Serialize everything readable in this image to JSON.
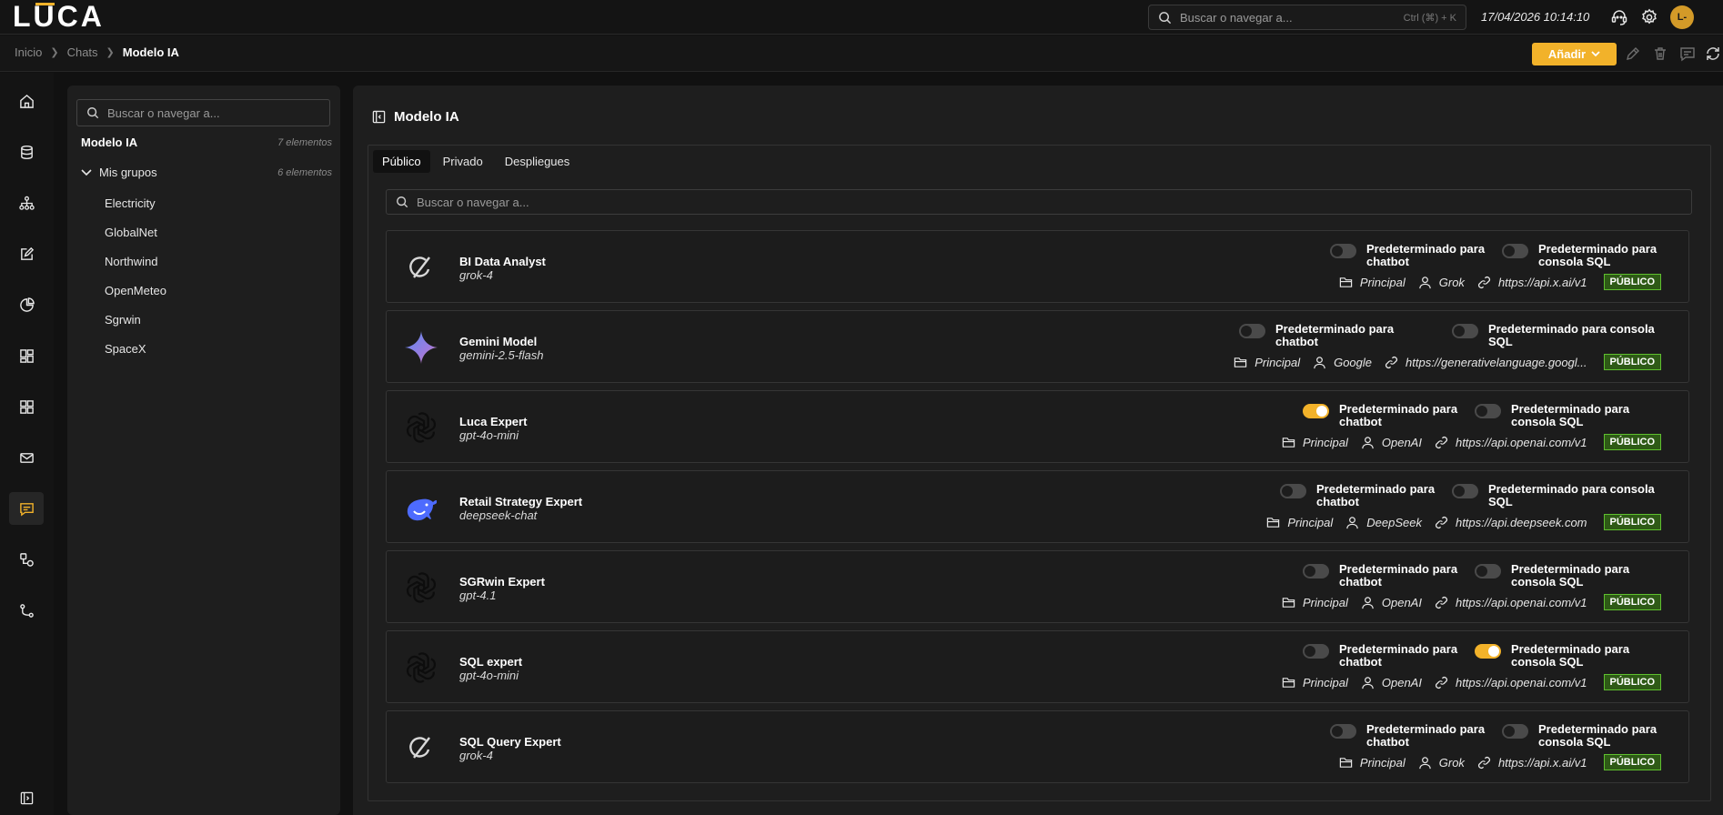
{
  "header": {
    "logo_text": "LUCA",
    "search_placeholder": "Buscar o navegar a...",
    "search_shortcut": "Ctrl (⌘) + K",
    "datetime": "17/04/2026 10:14:10",
    "avatar_initials": "L-",
    "accent_color": "#f2b22a"
  },
  "breadcrumb": {
    "items": [
      "Inicio",
      "Chats"
    ],
    "current": "Modelo IA"
  },
  "toolbar": {
    "add_label": "Añadir"
  },
  "sidebar": {
    "icons": [
      "home-icon",
      "database-icon",
      "hierarchy-icon",
      "edit-icon",
      "pie-chart-icon",
      "dashboard-icon",
      "grid-icon",
      "mail-icon",
      "chat-icon",
      "flow-icon",
      "branch-icon",
      "collapse-icon"
    ],
    "active": "chat-icon"
  },
  "tree": {
    "search_placeholder": "Buscar o navegar a...",
    "root_label": "Modelo IA",
    "root_count": "7 elementos",
    "group_label": "Mis grupos",
    "group_count": "6 elementos",
    "items": [
      "Electricity",
      "GlobalNet",
      "Northwind",
      "OpenMeteo",
      "Sgrwin",
      "SpaceX"
    ]
  },
  "main": {
    "title": "Modelo IA",
    "tabs": [
      "Público",
      "Privado",
      "Despliegues"
    ],
    "active_tab": "Público",
    "search_placeholder": "Buscar o navegar a...",
    "models": [
      {
        "name": "BI Data Analyst",
        "model": "grok-4",
        "icon": "grok-icon",
        "chatbot_label": "Predeterminado para chatbot",
        "chatbot_on": false,
        "sql_label": "Predeterminado para consola SQL",
        "sql_on": false,
        "folder": "Principal",
        "provider": "Grok",
        "url": "https://api.x.ai/v1",
        "badge": "PÚBLICO"
      },
      {
        "name": "Gemini Model",
        "model": "gemini-2.5-flash",
        "icon": "gemini-icon",
        "chatbot_label": "Predeterminado para chatbot",
        "chatbot_on": false,
        "sql_label": "Predeterminado para consola SQL",
        "sql_on": false,
        "folder": "Principal",
        "provider": "Google",
        "url": "https://generativelanguage.googl...",
        "badge": "PÚBLICO"
      },
      {
        "name": "Luca Expert",
        "model": "gpt-4o-mini",
        "icon": "openai-icon",
        "chatbot_label": "Predeterminado para chatbot",
        "chatbot_on": true,
        "sql_label": "Predeterminado para consola SQL",
        "sql_on": false,
        "folder": "Principal",
        "provider": "OpenAI",
        "url": "https://api.openai.com/v1",
        "badge": "PÚBLICO"
      },
      {
        "name": "Retail Strategy Expert",
        "model": "deepseek-chat",
        "icon": "deepseek-icon",
        "chatbot_label": "Predeterminado para chatbot",
        "chatbot_on": false,
        "sql_label": "Predeterminado para consola SQL",
        "sql_on": false,
        "folder": "Principal",
        "provider": "DeepSeek",
        "url": "https://api.deepseek.com",
        "badge": "PÚBLICO"
      },
      {
        "name": "SGRwin Expert",
        "model": "gpt-4.1",
        "icon": "openai-icon",
        "chatbot_label": "Predeterminado para chatbot",
        "chatbot_on": false,
        "sql_label": "Predeterminado para consola SQL",
        "sql_on": false,
        "folder": "Principal",
        "provider": "OpenAI",
        "url": "https://api.openai.com/v1",
        "badge": "PÚBLICO"
      },
      {
        "name": "SQL expert",
        "model": "gpt-4o-mini",
        "icon": "openai-icon",
        "chatbot_label": "Predeterminado para chatbot",
        "chatbot_on": false,
        "sql_label": "Predeterminado para consola SQL",
        "sql_on": true,
        "folder": "Principal",
        "provider": "OpenAI",
        "url": "https://api.openai.com/v1",
        "badge": "PÚBLICO"
      },
      {
        "name": "SQL Query Expert",
        "model": "grok-4",
        "icon": "grok-icon",
        "chatbot_label": "Predeterminado para chatbot",
        "chatbot_on": false,
        "sql_label": "Predeterminado para consola SQL",
        "sql_on": false,
        "folder": "Principal",
        "provider": "Grok",
        "url": "https://api.x.ai/v1",
        "badge": "PÚBLICO"
      }
    ]
  }
}
